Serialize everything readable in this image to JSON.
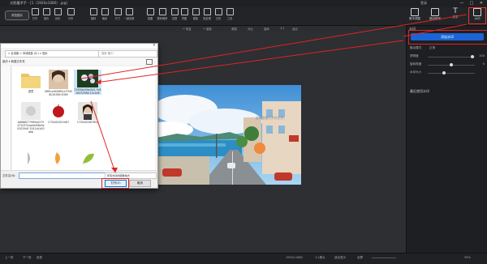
{
  "titlebar": {
    "app_title": "光影魔术手 - [1（1920x1080）.jpg]",
    "user_label": "登录",
    "min": "—",
    "max": "□",
    "close": "✕"
  },
  "toolbar": {
    "open_label": "浏览图片",
    "tools": [
      {
        "label": "打开",
        "icon": "open-icon"
      },
      {
        "label": "保存",
        "icon": "save-icon"
      },
      {
        "label": "另存",
        "icon": "save-as-icon"
      },
      {
        "label": "分享",
        "icon": "share-icon"
      },
      {
        "label": "旋转",
        "icon": "rotate-icon"
      },
      {
        "label": "裁剪",
        "icon": "crop-icon"
      },
      {
        "label": "尺寸",
        "icon": "resize-icon"
      },
      {
        "label": "一键设置",
        "icon": "auto-icon"
      },
      {
        "label": "抠图",
        "icon": "cutout-icon"
      },
      {
        "label": "数码暗房",
        "icon": "darkroom-icon"
      },
      {
        "label": "边框",
        "icon": "frame-icon"
      },
      {
        "label": "拼图",
        "icon": "collage-icon"
      },
      {
        "label": "模板",
        "icon": "template-icon"
      },
      {
        "label": "批处理",
        "icon": "batch-icon"
      },
      {
        "label": "日历",
        "icon": "calendar-icon"
      },
      {
        "label": "工具",
        "icon": "tools-icon"
      }
    ],
    "right_tools": [
      {
        "label": "基本调整",
        "icon": "adjust-icon"
      },
      {
        "label": "数码暗房",
        "icon": "darkroom-icon"
      },
      {
        "label": "文字",
        "icon": "text-icon"
      },
      {
        "label": "水印",
        "icon": "watermark-icon"
      }
    ]
  },
  "subbar": {
    "undo": "↶ 恢复",
    "redo": "↷ 重做",
    "original": "原图",
    "compare": "对比",
    "rotate": "旋转",
    "fit": "1:1",
    "fit2": "适应"
  },
  "canvas": {
    "placeholder": "选择图像打开的文件。"
  },
  "rightpanel": {
    "header": "水印",
    "add_button": "添加水印",
    "rows": [
      {
        "label": "融合模式",
        "value": "正常",
        "has_slider": false
      },
      {
        "label": "透明度",
        "value": "",
        "num": "100",
        "level": 0.95
      },
      {
        "label": "旋转角度",
        "value": "",
        "num": "0",
        "level": 0.5
      },
      {
        "label": "水印大小",
        "value": "",
        "num": "",
        "level": 0.35
      }
    ],
    "section": "最近使用水印"
  },
  "dialog": {
    "address": "> 此电脑 > 本地磁盘 (D:) > 图片",
    "search_placeholder": "搜索\"图片\"",
    "organize": "组织 ▾   新建文件夹",
    "files": [
      {
        "name": "遮罩"
      },
      {
        "name": "0f65ca4f4985ccf7f458016389 8369"
      },
      {
        "name": "17830b50bc542 7b53e23358d 12c1e8"
      },
      {
        "name": "b6688277990ee2754720374aa9a5f8e0e03025d5 5241b1b52dbb"
      },
      {
        "name": "1730402001087"
      },
      {
        "name": "1730402087654"
      },
      {
        "name": ""
      },
      {
        "name": ""
      },
      {
        "name": ""
      }
    ],
    "filename_label": "文件名(N):",
    "filetype": "所有支持的图像格式",
    "open_button": "打开(O)",
    "cancel_button": "取消"
  },
  "statusbar": {
    "prev": "上一张",
    "next": "下一张",
    "info": "信息",
    "size": "1920×1080",
    "zoom_label": "1:1原大",
    "fit": "适合显示",
    "fullscreen": "全屏",
    "pct": "35%"
  },
  "colors": {
    "accent": "#1a64d6",
    "annotation": "#e02424"
  }
}
